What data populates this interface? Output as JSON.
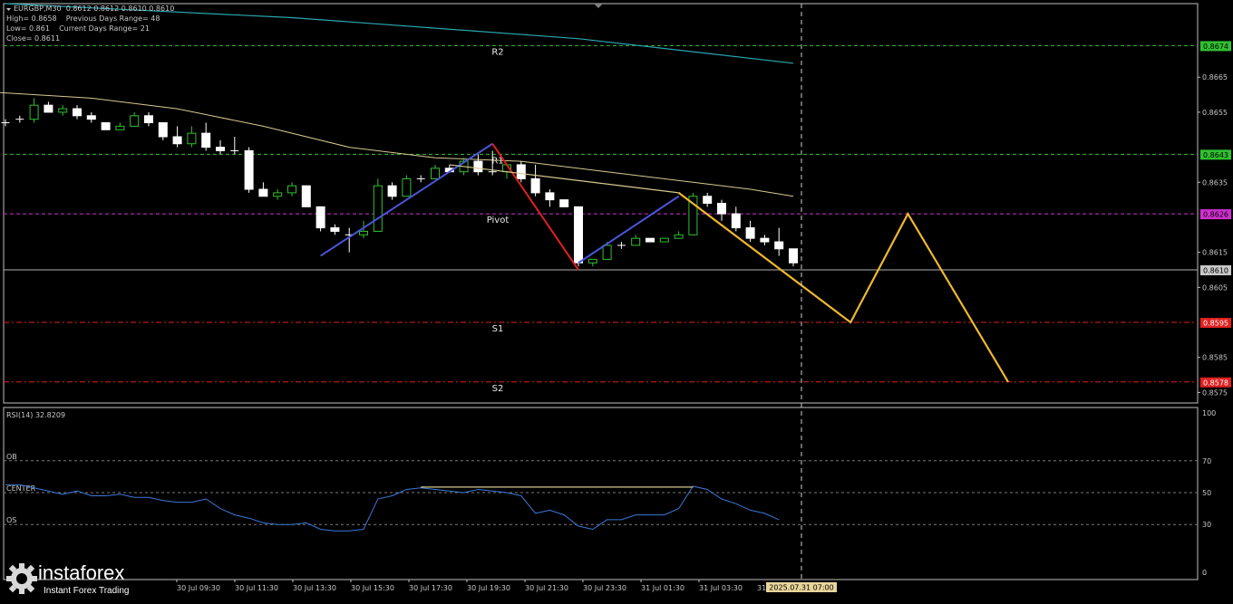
{
  "header": {
    "symbol_line": "EURGBP,M30  0.8612 0.8612 0.8610 0.8610",
    "high_line": "High= 0.8658    Previous Days Range= 48",
    "low_line": "Low= 0.861    Current Days Range= 21",
    "close_line": "Close= 0.8611"
  },
  "rsi": {
    "title": "RSI(14) 32.8209",
    "levels": [
      {
        "label": "OB",
        "value": 70
      },
      {
        "label": "CENTER",
        "value": 50
      },
      {
        "label": "OS",
        "value": 30
      }
    ],
    "ticks": [
      "100",
      "70",
      "50",
      "30",
      "0"
    ]
  },
  "colors": {
    "bg": "#000000",
    "candle_up": "#000000",
    "candle_down": "#ffffff",
    "candle_edge": "#30c030",
    "ma_long": "#2aa6b0",
    "ma_mid": "#d8c890",
    "up_wave": "#4a55d8",
    "down_wave": "#e02020",
    "forecast": "#f0b830",
    "rsi_line": "#3a78d8",
    "pivot_level": "#d030d0",
    "resist_level": "#30c030",
    "support_level": "#e02020"
  },
  "chart_data": {
    "type": "candlestick",
    "symbol": "EURGBP",
    "timeframe": "M30",
    "ylim": [
      0.8572,
      0.8686
    ],
    "y_ticks": [
      "0.8665",
      "0.8655",
      "0.8635",
      "0.8615",
      "0.8605",
      "0.8585",
      "0.8575"
    ],
    "x_ticks": [
      "30 Jul 09:30",
      "30 Jul 11:30",
      "30 Jul 13:30",
      "30 Jul 15:30",
      "30 Jul 17:30",
      "30 Jul 19:30",
      "30 Jul 21:30",
      "30 Jul 23:30",
      "31 Jul 01:30",
      "31 Jul 03:30"
    ],
    "x_tick_partial": "31",
    "cursor_time": "2025.07.31 07:00",
    "current_price": {
      "label": "0.8610",
      "value": 0.861
    },
    "levels": [
      {
        "name": "R2",
        "value": 0.8674,
        "price_label": "0.8674",
        "kind": "resistance"
      },
      {
        "name": "R1",
        "value": 0.8643,
        "price_label": "0.8643",
        "kind": "resistance"
      },
      {
        "name": "Pivot",
        "value": 0.8626,
        "price_label": "0.8626",
        "kind": "pivot"
      },
      {
        "name": "S1",
        "value": 0.8595,
        "price_label": "0.8595",
        "kind": "support"
      },
      {
        "name": "S2",
        "value": 0.8578,
        "price_label": "0.8578",
        "kind": "support"
      }
    ],
    "candles": [
      [
        0.8652,
        0.8653,
        0.8651,
        0.8652
      ],
      [
        0.8653,
        0.8654,
        0.8652,
        0.8653
      ],
      [
        0.8653,
        0.8659,
        0.8652,
        0.8657
      ],
      [
        0.8657,
        0.8658,
        0.8655,
        0.8655
      ],
      [
        0.8655,
        0.8657,
        0.8654,
        0.8656
      ],
      [
        0.8656,
        0.8657,
        0.8653,
        0.8654
      ],
      [
        0.8654,
        0.8655,
        0.8652,
        0.8653
      ],
      [
        0.8652,
        0.8652,
        0.865,
        0.865
      ],
      [
        0.865,
        0.8652,
        0.865,
        0.8651
      ],
      [
        0.8651,
        0.8655,
        0.8651,
        0.8654
      ],
      [
        0.8654,
        0.8655,
        0.8651,
        0.8652
      ],
      [
        0.8652,
        0.8652,
        0.8647,
        0.8648
      ],
      [
        0.8648,
        0.8651,
        0.8645,
        0.8646
      ],
      [
        0.8646,
        0.8651,
        0.8645,
        0.8649
      ],
      [
        0.8649,
        0.8652,
        0.8644,
        0.8645
      ],
      [
        0.8645,
        0.8647,
        0.8643,
        0.8644
      ],
      [
        0.8644,
        0.8648,
        0.8643,
        0.8644
      ],
      [
        0.8644,
        0.8645,
        0.8632,
        0.8633
      ],
      [
        0.8633,
        0.8635,
        0.8631,
        0.8631
      ],
      [
        0.8631,
        0.8633,
        0.863,
        0.8632
      ],
      [
        0.8632,
        0.8635,
        0.8631,
        0.8634
      ],
      [
        0.8634,
        0.8634,
        0.8628,
        0.8628
      ],
      [
        0.8628,
        0.8628,
        0.8621,
        0.8622
      ],
      [
        0.8622,
        0.8623,
        0.862,
        0.8621
      ],
      [
        0.862,
        0.8622,
        0.8615,
        0.862
      ],
      [
        0.862,
        0.8624,
        0.8619,
        0.8621
      ],
      [
        0.8621,
        0.8636,
        0.8621,
        0.8634
      ],
      [
        0.8634,
        0.8635,
        0.863,
        0.8631
      ],
      [
        0.8631,
        0.8637,
        0.8631,
        0.8636
      ],
      [
        0.8636,
        0.8637,
        0.8635,
        0.8636
      ],
      [
        0.8636,
        0.864,
        0.8636,
        0.8639
      ],
      [
        0.8639,
        0.864,
        0.8638,
        0.8638
      ],
      [
        0.8638,
        0.8642,
        0.8637,
        0.8641
      ],
      [
        0.8641,
        0.8643,
        0.8637,
        0.8638
      ],
      [
        0.8638,
        0.8644,
        0.8637,
        0.8638
      ],
      [
        0.8638,
        0.864,
        0.8636,
        0.864
      ],
      [
        0.864,
        0.8641,
        0.8635,
        0.8636
      ],
      [
        0.8636,
        0.864,
        0.8631,
        0.8632
      ],
      [
        0.8632,
        0.8633,
        0.8628,
        0.863
      ],
      [
        0.863,
        0.863,
        0.8628,
        0.8628
      ],
      [
        0.8628,
        0.8628,
        0.8611,
        0.8612
      ],
      [
        0.8612,
        0.8613,
        0.8611,
        0.8613
      ],
      [
        0.8613,
        0.8618,
        0.8613,
        0.8617
      ],
      [
        0.8617,
        0.8618,
        0.8616,
        0.8617
      ],
      [
        0.8617,
        0.862,
        0.8617,
        0.8619
      ],
      [
        0.8619,
        0.8619,
        0.8618,
        0.8618
      ],
      [
        0.8618,
        0.8619,
        0.8618,
        0.8619
      ],
      [
        0.8619,
        0.8621,
        0.8619,
        0.862
      ],
      [
        0.862,
        0.8632,
        0.862,
        0.8631
      ],
      [
        0.8631,
        0.8632,
        0.8628,
        0.8629
      ],
      [
        0.8629,
        0.863,
        0.8624,
        0.8626
      ],
      [
        0.8626,
        0.8628,
        0.8621,
        0.8622
      ],
      [
        0.8622,
        0.8624,
        0.8618,
        0.8619
      ],
      [
        0.8619,
        0.862,
        0.8617,
        0.8618
      ],
      [
        0.8618,
        0.8622,
        0.8614,
        0.8616
      ],
      [
        0.8616,
        0.8616,
        0.8611,
        0.8612
      ]
    ],
    "ma_long": [
      [
        0,
        0.8686
      ],
      [
        20,
        0.8682
      ],
      [
        40,
        0.8676
      ],
      [
        55,
        0.8669
      ]
    ],
    "ma_mid": [
      [
        -2,
        0.8661
      ],
      [
        6,
        0.8659
      ],
      [
        12,
        0.8656
      ],
      [
        18,
        0.8651
      ],
      [
        24,
        0.8645
      ],
      [
        30,
        0.8642
      ],
      [
        36,
        0.8641
      ],
      [
        42,
        0.8638
      ],
      [
        48,
        0.8635
      ],
      [
        52,
        0.8633
      ],
      [
        55,
        0.8631
      ]
    ],
    "waves": [
      {
        "from": [
          22,
          0.8614
        ],
        "to": [
          34,
          0.8646
        ],
        "kind": "up"
      },
      {
        "from": [
          34,
          0.8646
        ],
        "to": [
          40,
          0.861
        ],
        "kind": "down"
      },
      {
        "from": [
          40,
          0.8612
        ],
        "to": [
          47,
          0.8631
        ],
        "kind": "up"
      },
      {
        "from": [
          31,
          0.864
        ],
        "to": [
          47,
          0.8632
        ],
        "kind": "trendline"
      }
    ],
    "forecast": [
      [
        47,
        0.8632
      ],
      [
        59,
        0.8595
      ],
      [
        63,
        0.8626
      ],
      [
        70,
        0.8578
      ]
    ],
    "rsi_values": [
      55,
      55,
      53,
      51,
      49,
      51,
      48,
      48,
      49,
      47,
      47,
      45,
      44,
      44,
      46,
      40,
      36,
      34,
      31,
      30,
      30,
      31,
      27,
      26,
      26,
      27,
      46,
      48,
      52,
      53,
      52,
      51,
      50,
      52,
      51,
      50,
      48,
      37,
      39,
      36,
      29,
      27,
      33,
      33,
      36,
      36,
      36,
      40,
      54,
      52,
      46,
      43,
      39,
      37,
      33
    ]
  }
}
